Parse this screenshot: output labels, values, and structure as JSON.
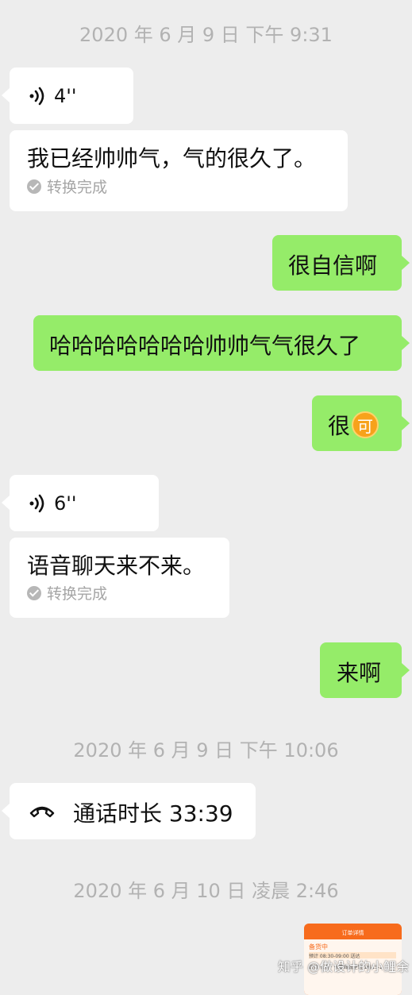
{
  "timestamps": {
    "t1": "2020 年 6 月 9 日  下午 9:31",
    "t2": "2020 年 6 月 9 日  下午 10:06",
    "t3": "2020 年 6 月 10 日  凌晨 2:46"
  },
  "messages": {
    "voice1": {
      "duration": "4''",
      "icon": "voice-wave-icon"
    },
    "transcript1": {
      "text": "我已经帅帅气，气的很久了。",
      "status": "转换完成"
    },
    "out1": {
      "text": "很自信啊"
    },
    "out2": {
      "text": "哈哈哈哈哈哈哈帅帅气气很久了"
    },
    "out3": {
      "text": "很",
      "emoji_text": "可"
    },
    "voice2": {
      "duration": "6''",
      "icon": "voice-wave-icon"
    },
    "transcript2": {
      "text": "语音聊天来不来。",
      "status": "转换完成"
    },
    "out4": {
      "text": "来啊"
    },
    "call": {
      "text": "通话时长 33:39",
      "icon": "phone-hangup-icon"
    }
  },
  "thumbnail": {
    "header": "订单详情",
    "status": "备货中",
    "line2": "预计 08:30-09:00 送达",
    "line3": "蔬行  长寿 · 长嘉城城堡馆 1栋15-2"
  },
  "watermark": "知乎 @做设计的小鲤余",
  "colors": {
    "background": "#ededed",
    "incoming": "#ffffff",
    "outgoing": "#95ec69",
    "timestamp": "#b2b2b2"
  }
}
